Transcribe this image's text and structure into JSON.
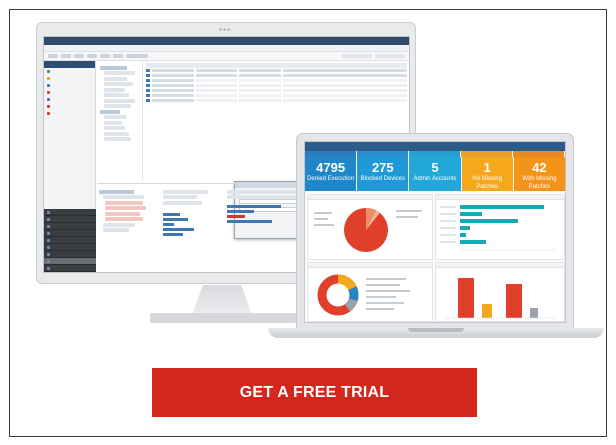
{
  "cta": {
    "label": "GET A FREE TRIAL",
    "color": "#d3261d"
  },
  "laptop_dashboard": {
    "kpis": [
      {
        "value": "4795",
        "label": "Denied Execution",
        "color": "#1f86c8"
      },
      {
        "value": "275",
        "label": "Blocked Devices",
        "color": "#1f9ad6"
      },
      {
        "value": "5",
        "label": "Admin Accounts",
        "color": "#22a8d8"
      },
      {
        "value": "1",
        "label": "No Missing Patches",
        "color": "#f4a81c"
      },
      {
        "value": "42",
        "label": "With Missing Patches",
        "color": "#f39419"
      }
    ],
    "accent_red": "#e0402b",
    "accent_teal": "#1aa8b4"
  },
  "colors": {
    "app_titlebar": "#2f4a6a",
    "nav_header": "#2c4e76",
    "nav_dark": "#3a3d42"
  }
}
